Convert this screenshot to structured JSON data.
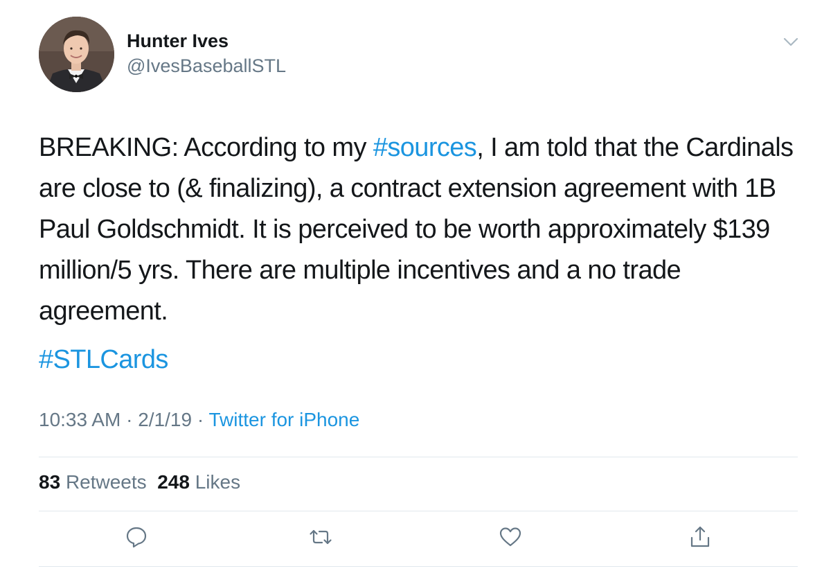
{
  "author": {
    "display_name": "Hunter Ives",
    "handle": "@IvesBaseballSTL",
    "avatar_icon": "user-portrait"
  },
  "tweet": {
    "text_before": "BREAKING: According to my ",
    "inline_hashtag": "#sources",
    "text_after": ", I am told that the Cardinals are close to (& finalizing), a contract extension agreement with 1B Paul Goldschmidt. It is perceived to be worth approximately $139 million/5 yrs. There are multiple incentives and a no trade agreement.",
    "tag_line": "#STLCards",
    "time": "10:33 AM",
    "date": "2/1/19",
    "separator": "·",
    "source": "Twitter for iPhone"
  },
  "stats": {
    "retweets_count": "83",
    "retweets_label": "Retweets",
    "likes_count": "248",
    "likes_label": "Likes"
  },
  "actions": [
    {
      "icon": "reply-icon"
    },
    {
      "icon": "retweet-icon"
    },
    {
      "icon": "like-icon"
    },
    {
      "icon": "share-icon"
    }
  ],
  "colors": {
    "link": "#1b95e0",
    "secondary_text": "#657786",
    "primary_text": "#14171a",
    "divider": "#e1e8ed"
  }
}
